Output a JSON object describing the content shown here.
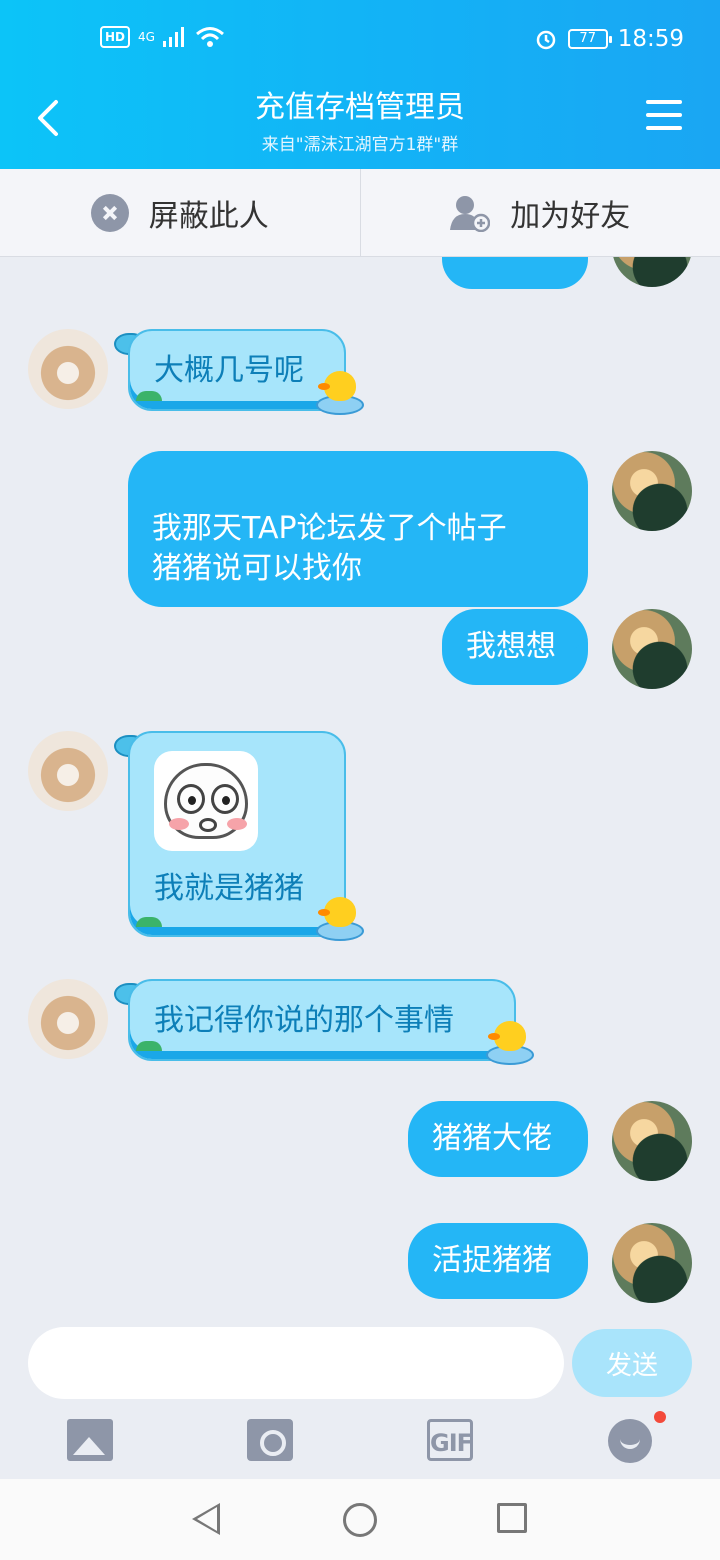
{
  "status_bar": {
    "time": "18:59",
    "battery": "77",
    "hd_label": "HD",
    "network": "4G",
    "icons": [
      "hd-icon",
      "signal-icon",
      "wifi-icon",
      "alarm-icon",
      "battery-icon"
    ]
  },
  "header": {
    "title": "充值存档管理员",
    "subtitle": "来自\"濡沫江湖官方1群\"群",
    "back_icon": "chevron-left-icon",
    "menu_icon": "hamburger-icon"
  },
  "actions": {
    "block_label": "屏蔽此人",
    "add_friend_label": "加为好友"
  },
  "messages": [
    {
      "side": "in",
      "text": "大概几号呢"
    },
    {
      "side": "out",
      "text": "我那天TAP论坛发了个帖子\n猪猪说可以找你"
    },
    {
      "side": "out",
      "text": "我想想"
    },
    {
      "side": "in",
      "text": "我就是猪猪",
      "has_sticker": true
    },
    {
      "side": "in",
      "text": "我记得你说的那个事情"
    },
    {
      "side": "out",
      "text": "猪猪大佬"
    },
    {
      "side": "out",
      "text": "活捉猪猪"
    }
  ],
  "input": {
    "value": "",
    "placeholder": "",
    "send_label": "发送"
  },
  "toolbar": {
    "gif_label": "GIF",
    "icons": [
      "image-icon",
      "camera-icon",
      "gif-icon",
      "emoji-icon"
    ]
  },
  "colors": {
    "header": "#13b2f6",
    "bubble_out": "#24b6f6",
    "bubble_in": "#a7e5fb",
    "chat_bg": "#eaedf3"
  }
}
